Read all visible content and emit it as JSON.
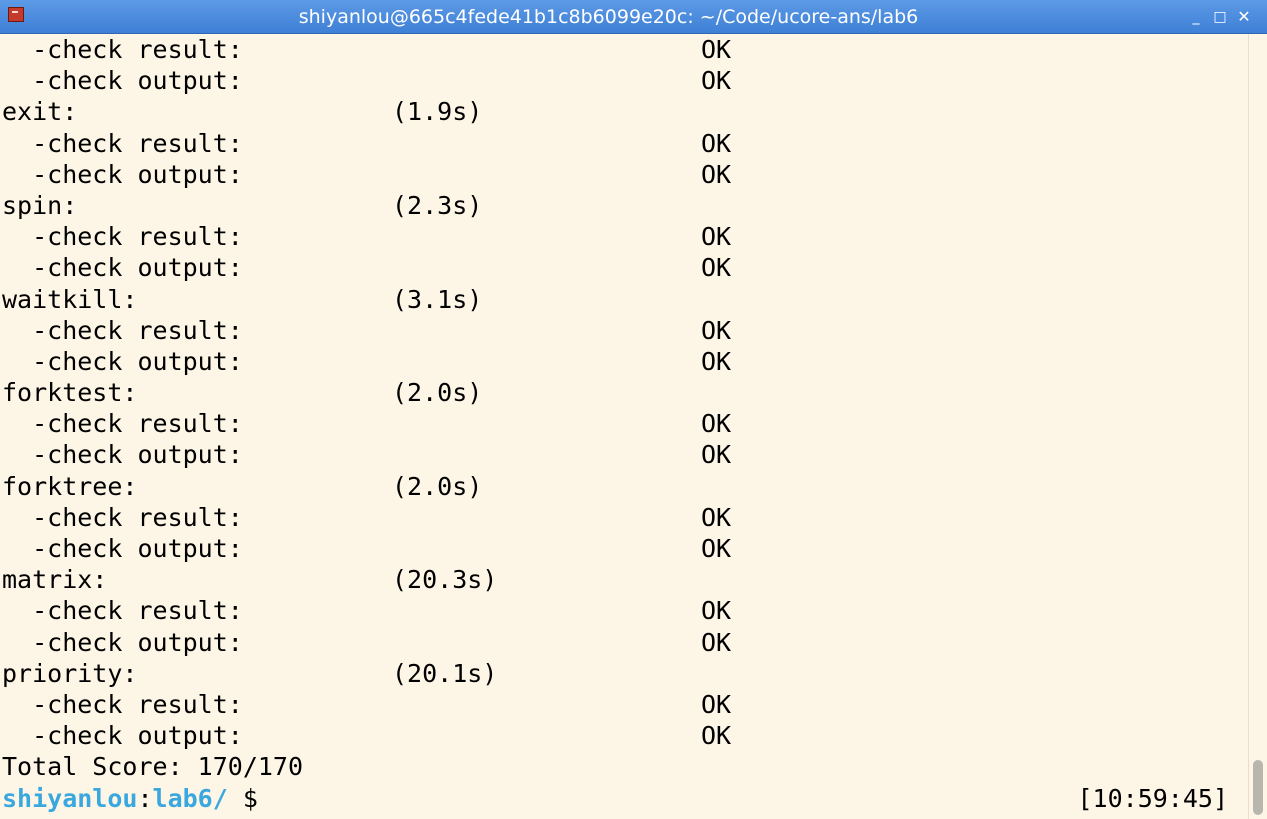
{
  "window": {
    "title": "shiyanlou@665c4fede41b1c8b6099e20c: ~/Code/ucore-ans/lab6",
    "controls": {
      "minimize": "_",
      "maximize": "□",
      "close": "✕"
    },
    "icon": "terminal-app-icon"
  },
  "terminal": {
    "lines": [
      {
        "label": "  -check result:",
        "time": "",
        "status": "OK"
      },
      {
        "label": "  -check output:",
        "time": "",
        "status": "OK"
      },
      {
        "label": "exit:",
        "time": "(1.9s)",
        "status": ""
      },
      {
        "label": "  -check result:",
        "time": "",
        "status": "OK"
      },
      {
        "label": "  -check output:",
        "time": "",
        "status": "OK"
      },
      {
        "label": "spin:",
        "time": "(2.3s)",
        "status": ""
      },
      {
        "label": "  -check result:",
        "time": "",
        "status": "OK"
      },
      {
        "label": "  -check output:",
        "time": "",
        "status": "OK"
      },
      {
        "label": "waitkill:",
        "time": "(3.1s)",
        "status": ""
      },
      {
        "label": "  -check result:",
        "time": "",
        "status": "OK"
      },
      {
        "label": "  -check output:",
        "time": "",
        "status": "OK"
      },
      {
        "label": "forktest:",
        "time": "(2.0s)",
        "status": ""
      },
      {
        "label": "  -check result:",
        "time": "",
        "status": "OK"
      },
      {
        "label": "  -check output:",
        "time": "",
        "status": "OK"
      },
      {
        "label": "forktree:",
        "time": "(2.0s)",
        "status": ""
      },
      {
        "label": "  -check result:",
        "time": "",
        "status": "OK"
      },
      {
        "label": "  -check output:",
        "time": "",
        "status": "OK"
      },
      {
        "label": "matrix:",
        "time": "(20.3s)",
        "status": ""
      },
      {
        "label": "  -check result:",
        "time": "",
        "status": "OK"
      },
      {
        "label": "  -check output:",
        "time": "",
        "status": "OK"
      },
      {
        "label": "priority:",
        "time": "(20.1s)",
        "status": ""
      },
      {
        "label": "  -check result:",
        "time": "",
        "status": "OK"
      },
      {
        "label": "  -check output:",
        "time": "",
        "status": "OK"
      }
    ],
    "total_score": "Total Score: 170/170",
    "prompt": {
      "user": "shiyanlou",
      "separator": ":",
      "path": "lab6/",
      "symbol": " $",
      "clock": "[10:59:45]"
    }
  },
  "colors": {
    "background": "#fdf6e6",
    "titlebar": "#4a8ade",
    "prompt": "#3aa7de"
  }
}
